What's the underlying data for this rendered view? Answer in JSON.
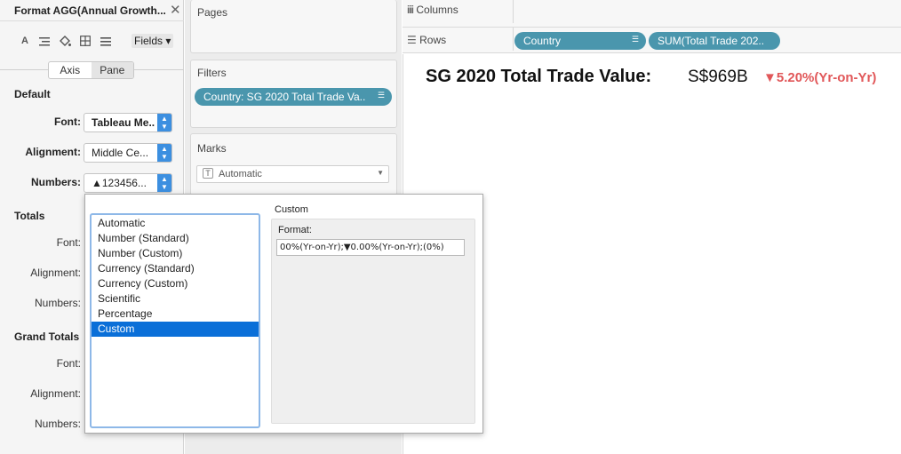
{
  "format_pane": {
    "title": "Format AGG(Annual Growth...",
    "close_glyph": "✕",
    "fields_label": "Fields ▾",
    "tabs": [
      "Axis",
      "Pane"
    ],
    "selected_tab": "Pane",
    "default_section": {
      "title": "Default",
      "font_label": "Font:",
      "font_value": "Tableau Me..",
      "alignment_label": "Alignment:",
      "alignment_value": "Middle Ce...",
      "numbers_label": "Numbers:",
      "numbers_value": "▲123456..."
    },
    "totals_section": {
      "title": "Totals",
      "font_label": "Font:",
      "alignment_label": "Alignment:",
      "numbers_label": "Numbers:"
    },
    "grand_totals_section": {
      "title": "Grand Totals",
      "font_label": "Font:",
      "alignment_label": "Alignment:",
      "numbers_label": "Numbers:"
    }
  },
  "shelves": {
    "pages_title": "Pages",
    "filters_title": "Filters",
    "filter_pill": "Country: SG 2020 Total Trade Va..",
    "marks_title": "Marks",
    "marks_type": "Automatic",
    "columns_label": "Columns",
    "rows_label": "Rows",
    "row_pills": [
      "Country",
      "SUM(Total Trade 202.."
    ]
  },
  "view": {
    "title": "SG 2020 Total Trade Value:",
    "value": "S$969B",
    "change": "▼5.20%(Yr-on-Yr)"
  },
  "popup": {
    "format_types": [
      "Automatic",
      "Number (Standard)",
      "Number (Custom)",
      "Currency (Standard)",
      "Currency (Custom)",
      "Scientific",
      "Percentage",
      "Custom"
    ],
    "selected_type": "Custom",
    "panel_title": "Custom",
    "format_label": "Format:",
    "format_value": "00%(Yr-on-Yr);▼0.00%(Yr-on-Yr);(0%)"
  },
  "colors": {
    "pill": "#4a96ad",
    "selection": "#0a6fd8",
    "negative": "#e15759"
  }
}
